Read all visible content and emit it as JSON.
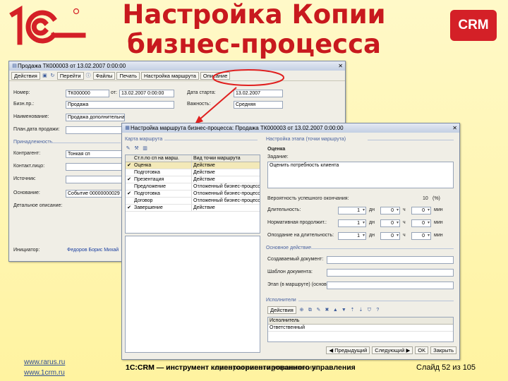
{
  "slide": {
    "title_line1": "Настройка Копии",
    "title_line2": "бизнес-процесса",
    "crm_badge": "CRM",
    "footer_center": "1C:CRM — инструмент клиентоориентированного управления",
    "footer_center_overlap": "1C:CRM — инструмент корпоративного управления",
    "footer_links": [
      "www.rarus.ru",
      "www.1crm.ru"
    ],
    "slide_label": "Слайд",
    "slide_num": "52",
    "slide_of": "из",
    "slide_total": "105"
  },
  "colors": {
    "title": "#c8191e",
    "crm_badge": "#d42027",
    "arrow": "#e0201f"
  },
  "back_window": {
    "title": "Продажа ТК000003 от 13.02.2007 0:00:00",
    "toolbar": {
      "actions": "Действия",
      "goto": "Перейти",
      "files": "Файлы",
      "print": "Печать",
      "route": "Настройка маршрута",
      "description": "Описание"
    },
    "fields": {
      "number_label": "Номер:",
      "number_value": "ТК000000",
      "from_label": "от:",
      "from_value": "13.02.2007 0:00:00",
      "start_label": "Дата старта:",
      "start_value": "13.02.2007",
      "process_label": "Бизн.пр.:",
      "process_value": "Продажа",
      "importance_label": "Важность:",
      "importance_value": "Средняя",
      "name_label": "Наименование:",
      "name_value": "Продажа дополнительная",
      "plan_label": "План.дата продажи:",
      "section_label": "Принадлежность",
      "contractor_label": "Контрагент:",
      "contractor_value": "Тонкая сп",
      "contact_label": "Контакт.лицо:",
      "source_label": "Источник:",
      "basis_label": "Основание:",
      "basis_value": "Событие 00000000029",
      "desc_label": "Детальное описание:",
      "initiator_label": "Инициатор:",
      "initiator_value": "Федоров Борис Михай"
    }
  },
  "front_window": {
    "title": "Настройка маршрута бизнес-процесса: Продажа ТК000003 от 13.02.2007 0:00:00",
    "map_section": "Карта маршрута",
    "table_headers": [
      "Ст.п.по сп на марш.",
      "Вид точки маршрута"
    ],
    "rows": [
      {
        "checked": "✔",
        "point": "Оценка",
        "kind": "Действие"
      },
      {
        "checked": "",
        "point": "Подготовка",
        "kind": "Действие"
      },
      {
        "checked": "✔",
        "point": "Презентация",
        "kind": "Действие"
      },
      {
        "checked": "",
        "point": "Предложение",
        "kind": "Отложенный бизнес-процесс"
      },
      {
        "checked": "✔",
        "point": "Подготовка",
        "kind": "Отложенный бизнес-процесс"
      },
      {
        "checked": "",
        "point": "Договор",
        "kind": "Отложенный бизнес-процесс"
      },
      {
        "checked": "✔",
        "point": "Завершение",
        "kind": "Действие"
      }
    ],
    "settings_section": "Настройка этапа (точки маршрута)",
    "point_name": "Оценка",
    "task_label": "Задание:",
    "task_value": "Оценить потребность клиента",
    "probability_label": "Вероятность успешного окончания:",
    "probability_value": "10",
    "probability_unit": "(%)",
    "duration_rows": [
      {
        "label": "Длительность:",
        "d": "1",
        "h": "0",
        "m": "0"
      },
      {
        "label": "Нормативная продолжит.:",
        "d": "1",
        "h": "0",
        "m": "0"
      },
      {
        "label": "Опоздание на длительность:",
        "d": "1",
        "h": "0",
        "m": "0"
      }
    ],
    "units": {
      "days": "дн",
      "hours": "ч",
      "minutes": "мин"
    },
    "main_action_section": "Основное действие",
    "created_doc_label": "Создаваемый документ:",
    "template_label": "Шаблон документа:",
    "step_label": "Этап (в маршруте) (основное)",
    "executors_section": "Исполнители",
    "executors_actions": "Действия",
    "executors_header": "Исполнитель",
    "executors_row": "Ответственный",
    "buttons": {
      "prev": "Предыдущий",
      "next": "Следующий",
      "ok": "OK",
      "close": "Закрыть"
    }
  }
}
